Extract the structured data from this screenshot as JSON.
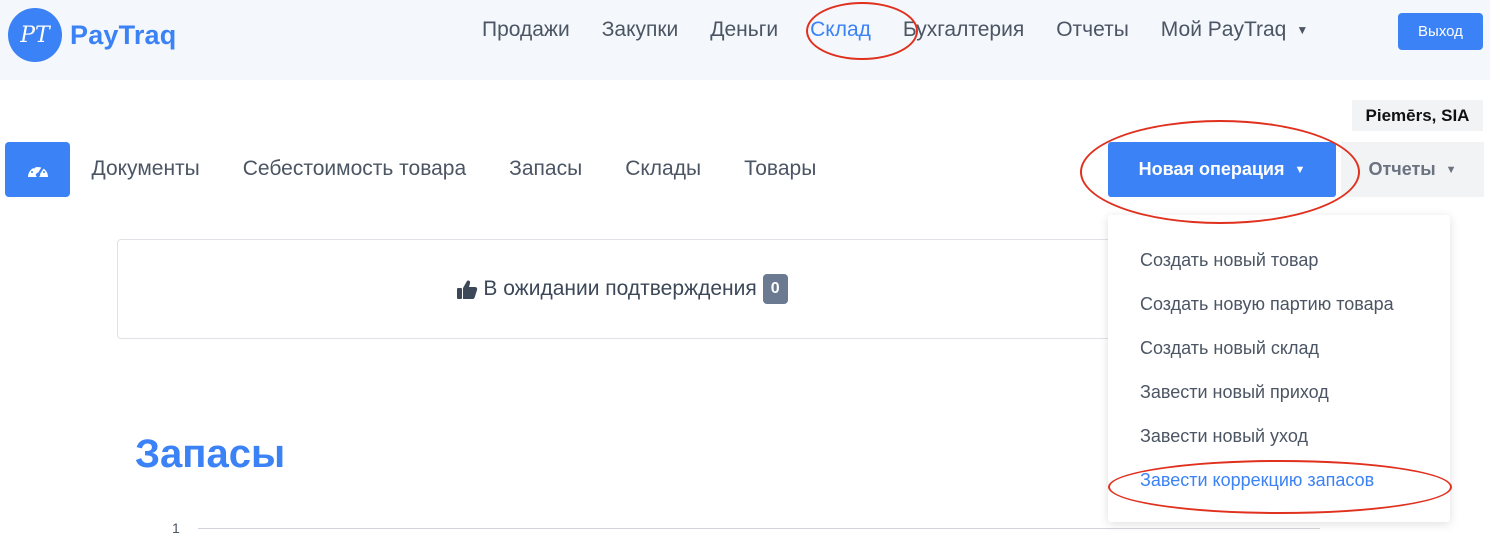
{
  "brand": {
    "logo_initials": "PT",
    "name": "PayTraq"
  },
  "top_nav": {
    "items": [
      {
        "label": "Продажи"
      },
      {
        "label": "Закупки"
      },
      {
        "label": "Деньги"
      },
      {
        "label": "Склад"
      },
      {
        "label": "Бухгалтерия"
      },
      {
        "label": "Отчеты"
      },
      {
        "label": "Мой PayTraq"
      }
    ],
    "active": "Склад",
    "logout_label": "Выход"
  },
  "company": "Piemērs, SIA",
  "sub_nav": {
    "dashboard_icon": "speedometer-icon",
    "items": [
      {
        "label": "Документы"
      },
      {
        "label": "Себестоимость товара"
      },
      {
        "label": "Запасы"
      },
      {
        "label": "Склады"
      },
      {
        "label": "Товары"
      }
    ],
    "new_operation_label": "Новая операция",
    "reports_label": "Отчеты"
  },
  "new_operation_menu": {
    "items": [
      {
        "label": "Создать новый товар"
      },
      {
        "label": "Создать новую партию товара"
      },
      {
        "label": "Создать новый склад"
      },
      {
        "label": "Завести новый приход"
      },
      {
        "label": "Завести новый уход"
      },
      {
        "label": "Завести коррекцию запасов"
      }
    ],
    "highlighted": "Завести коррекцию запасов"
  },
  "pending": {
    "icon": "thumbs-up-icon",
    "label": "В ожидании подтверждения",
    "count": "0"
  },
  "stock": {
    "title": "Запасы",
    "axis_tick": "1"
  },
  "colors": {
    "accent": "#3b82f6",
    "annotation": "#e0301e",
    "badge": "#6b7a90"
  }
}
